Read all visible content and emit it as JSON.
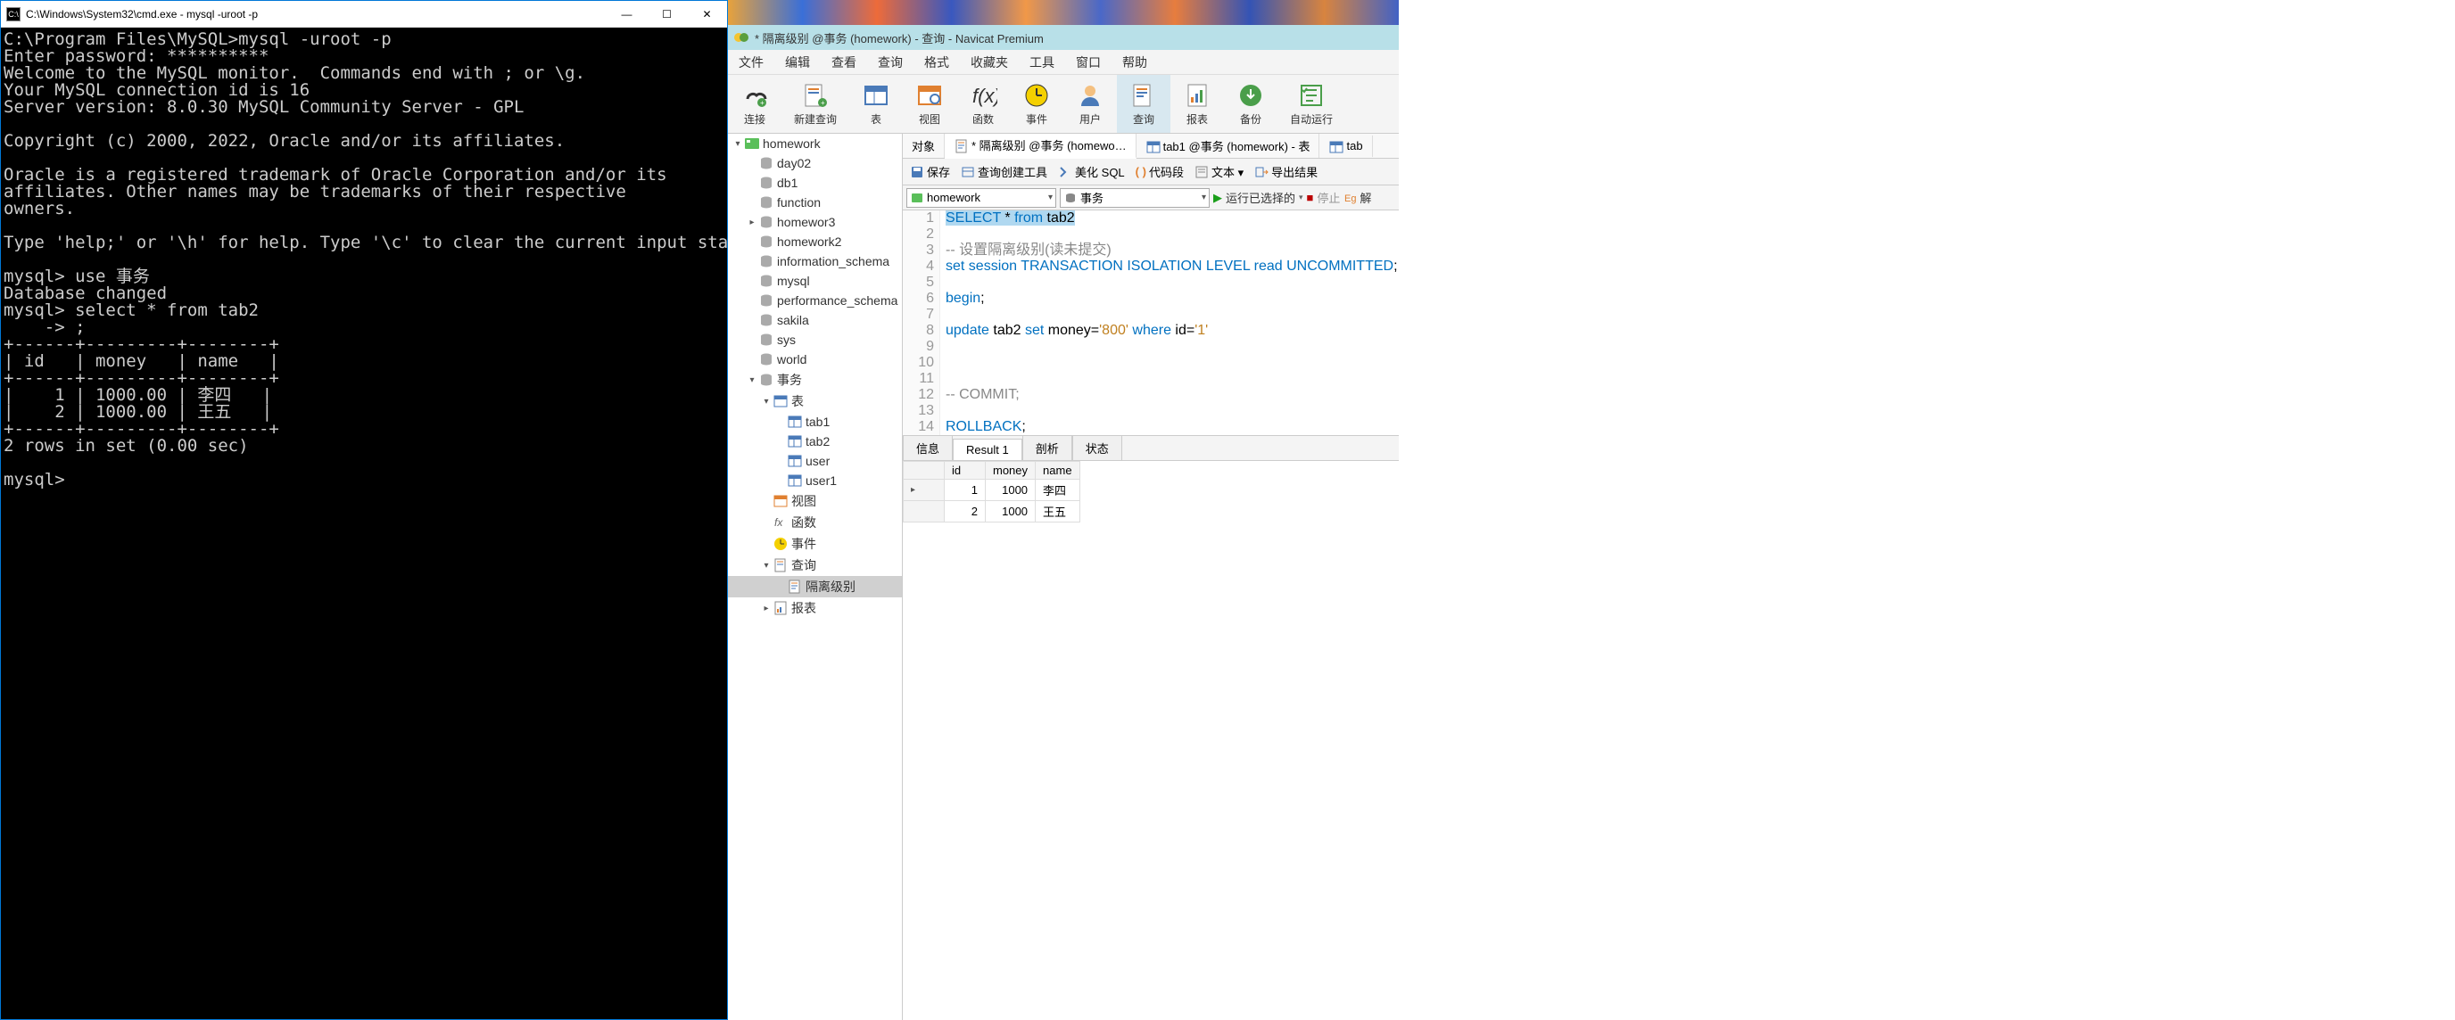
{
  "cmd": {
    "title": "C:\\Windows\\System32\\cmd.exe - mysql  -uroot -p",
    "content": "C:\\Program Files\\MySQL>mysql -uroot -p\nEnter password: **********\nWelcome to the MySQL monitor.  Commands end with ; or \\g.\nYour MySQL connection id is 16\nServer version: 8.0.30 MySQL Community Server - GPL\n\nCopyright (c) 2000, 2022, Oracle and/or its affiliates.\n\nOracle is a registered trademark of Oracle Corporation and/or its\naffiliates. Other names may be trademarks of their respective\nowners.\n\nType 'help;' or '\\h' for help. Type '\\c' to clear the current input statement.\n\nmysql> use 事务\nDatabase changed\nmysql> select * from tab2\n    -> ;\n+------+---------+--------+\n| id   | money   | name   |\n+------+---------+--------+\n|    1 | 1000.00 | 李四   |\n|    2 | 1000.00 | 王五   |\n+------+---------+--------+\n2 rows in set (0.00 sec)\n\nmysql>"
  },
  "navicat": {
    "title": "* 隔离级别 @事务 (homework) - 查询 - Navicat Premium",
    "menu": [
      "文件",
      "编辑",
      "查看",
      "查询",
      "格式",
      "收藏夹",
      "工具",
      "窗口",
      "帮助"
    ],
    "toolbar": [
      {
        "name": "connect",
        "label": "连接"
      },
      {
        "name": "new-query",
        "label": "新建查询"
      },
      {
        "name": "table",
        "label": "表"
      },
      {
        "name": "view",
        "label": "视图"
      },
      {
        "name": "function",
        "label": "函数"
      },
      {
        "name": "event",
        "label": "事件"
      },
      {
        "name": "user",
        "label": "用户"
      },
      {
        "name": "query",
        "label": "查询",
        "active": true
      },
      {
        "name": "report",
        "label": "报表"
      },
      {
        "name": "backup",
        "label": "备份"
      },
      {
        "name": "autorun",
        "label": "自动运行"
      }
    ],
    "sidebar": [
      {
        "d": 0,
        "arrow": "▾",
        "icon": "conn",
        "label": "homework"
      },
      {
        "d": 1,
        "icon": "db",
        "label": "day02"
      },
      {
        "d": 1,
        "icon": "db",
        "label": "db1"
      },
      {
        "d": 1,
        "icon": "db",
        "label": "function"
      },
      {
        "d": 1,
        "arrow": "▸",
        "icon": "db",
        "label": "homewor3"
      },
      {
        "d": 1,
        "icon": "db",
        "label": "homework2"
      },
      {
        "d": 1,
        "icon": "db",
        "label": "information_schema"
      },
      {
        "d": 1,
        "icon": "db",
        "label": "mysql"
      },
      {
        "d": 1,
        "icon": "db",
        "label": "performance_schema"
      },
      {
        "d": 1,
        "icon": "db",
        "label": "sakila"
      },
      {
        "d": 1,
        "icon": "db",
        "label": "sys"
      },
      {
        "d": 1,
        "icon": "db",
        "label": "world"
      },
      {
        "d": 1,
        "arrow": "▾",
        "icon": "db",
        "label": "事务"
      },
      {
        "d": 2,
        "arrow": "▾",
        "icon": "tbl",
        "label": "表"
      },
      {
        "d": 3,
        "icon": "tb",
        "label": "tab1"
      },
      {
        "d": 3,
        "icon": "tb",
        "label": "tab2"
      },
      {
        "d": 3,
        "icon": "tb",
        "label": "user"
      },
      {
        "d": 3,
        "icon": "tb",
        "label": "user1"
      },
      {
        "d": 2,
        "icon": "vw",
        "label": "视图"
      },
      {
        "d": 2,
        "icon": "fx",
        "label": "函数"
      },
      {
        "d": 2,
        "icon": "ev",
        "label": "事件"
      },
      {
        "d": 2,
        "arrow": "▾",
        "icon": "qr",
        "label": "查询"
      },
      {
        "d": 3,
        "icon": "qf",
        "label": "隔离级别",
        "sel": true
      },
      {
        "d": 2,
        "arrow": "▸",
        "icon": "rp",
        "label": "报表"
      }
    ],
    "tabs": [
      {
        "label": "对象"
      },
      {
        "label": "* 隔离级别 @事务 (homewo…",
        "active": true,
        "icon": "qf"
      },
      {
        "label": "tab1 @事务 (homework) - 表",
        "icon": "tb"
      },
      {
        "label": "tab",
        "icon": "tb"
      }
    ],
    "qbar": {
      "save": "保存",
      "builder": "查询创建工具",
      "beautify": "美化 SQL",
      "snippet": "代码段",
      "text": "文本 ▾",
      "export": "导出结果"
    },
    "qsel": {
      "db": "homework",
      "schema": "事务",
      "run": "运行已选择的",
      "stop": "停止",
      "explain": "解"
    },
    "code_lines": [
      {
        "n": 1,
        "html": "<span class='hl-sel'><span class='kw'>SELECT</span> * <span class='kw'>from</span> tab2</span>"
      },
      {
        "n": 2,
        "html": ""
      },
      {
        "n": 3,
        "html": "<span class='cm'>-- 设置隔离级别(读未提交)</span>"
      },
      {
        "n": 4,
        "html": "<span class='kw'>set</span> <span class='kw'>session</span> <span class='kw'>TRANSACTION ISOLATION LEVEL</span> <span class='kw'>read UNCOMMITTED</span>;"
      },
      {
        "n": 5,
        "html": ""
      },
      {
        "n": 6,
        "html": "<span class='kw'>begin</span>;"
      },
      {
        "n": 7,
        "html": ""
      },
      {
        "n": 8,
        "html": "<span class='kw'>update</span> tab2 <span class='kw'>set</span> money=<span class='str'>'800'</span> <span class='kw'>where</span> id=<span class='str'>'1'</span>"
      },
      {
        "n": 9,
        "html": ""
      },
      {
        "n": 10,
        "html": ""
      },
      {
        "n": 11,
        "html": ""
      },
      {
        "n": 12,
        "html": "<span class='cm'>-- COMMIT;</span>"
      },
      {
        "n": 13,
        "html": ""
      },
      {
        "n": 14,
        "html": "<span class='kw'>ROLLBACK</span>;"
      }
    ],
    "result_tabs": [
      "信息",
      "Result 1",
      "剖析",
      "状态"
    ],
    "result_active": 1,
    "result_cols": [
      "id",
      "money",
      "name"
    ],
    "result_rows": [
      {
        "ind": "▸",
        "cells": [
          "1",
          "1000",
          "李四"
        ]
      },
      {
        "ind": "",
        "cells": [
          "2",
          "1000",
          "王五"
        ]
      }
    ]
  }
}
